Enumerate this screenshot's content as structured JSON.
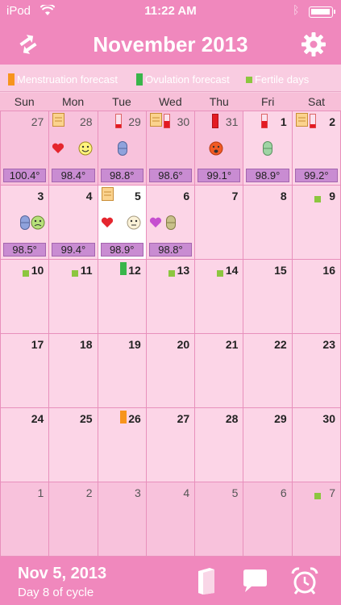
{
  "status_bar": {
    "carrier": "iPod",
    "time": "11:22 AM",
    "battery_level": 0.95
  },
  "header": {
    "title": "November 2013"
  },
  "legend": {
    "items": [
      {
        "label": "Menstruation forecast",
        "color": "#f7941d",
        "icon": "orange-bar"
      },
      {
        "label": "Ovulation forecast",
        "color": "#39b54a",
        "icon": "green-bar"
      },
      {
        "label": "Fertile days",
        "color": "#8cc63f",
        "icon": "green-square"
      }
    ]
  },
  "weekdays": [
    "Sun",
    "Mon",
    "Tue",
    "Wed",
    "Thu",
    "Fri",
    "Sat"
  ],
  "calendar": {
    "days": [
      {
        "d": "27",
        "other": true,
        "temp": "100.4°"
      },
      {
        "d": "28",
        "other": true,
        "temp": "98.4°",
        "icons": [
          "note",
          "heart",
          "smiley-happy"
        ]
      },
      {
        "d": "29",
        "other": true,
        "temp": "98.8°",
        "icons": [
          "flow-light",
          "pill-blue"
        ]
      },
      {
        "d": "30",
        "other": true,
        "temp": "98.6°",
        "icons": [
          "note",
          "flow-medium"
        ]
      },
      {
        "d": "31",
        "other": true,
        "temp": "99.1°",
        "icons": [
          "flow-heavy",
          "smiley-angry"
        ]
      },
      {
        "d": "1",
        "temp": "98.9°",
        "icons": [
          "flow-medium",
          "pill-green"
        ]
      },
      {
        "d": "2",
        "temp": "99.2°",
        "icons": [
          "note",
          "flow-light"
        ]
      },
      {
        "d": "3",
        "temp": "98.5°",
        "icons": [
          "pill-blue",
          "smiley-sad"
        ]
      },
      {
        "d": "4",
        "temp": "99.4°"
      },
      {
        "d": "5",
        "today": true,
        "temp": "98.9°",
        "icons": [
          "note",
          "heart",
          "smiley-neutral"
        ]
      },
      {
        "d": "6",
        "temp": "98.8°",
        "icons": [
          "heart-purple",
          "pill-tan"
        ]
      },
      {
        "d": "7"
      },
      {
        "d": "8"
      },
      {
        "d": "9",
        "icons": [
          "fertile"
        ]
      },
      {
        "d": "10",
        "icons": [
          "fertile"
        ]
      },
      {
        "d": "11",
        "icons": [
          "fertile"
        ]
      },
      {
        "d": "12",
        "icons": [
          "ovulation"
        ]
      },
      {
        "d": "13",
        "icons": [
          "fertile"
        ]
      },
      {
        "d": "14",
        "icons": [
          "fertile"
        ]
      },
      {
        "d": "15"
      },
      {
        "d": "16"
      },
      {
        "d": "17"
      },
      {
        "d": "18"
      },
      {
        "d": "19"
      },
      {
        "d": "20"
      },
      {
        "d": "21"
      },
      {
        "d": "22"
      },
      {
        "d": "23"
      },
      {
        "d": "24"
      },
      {
        "d": "25"
      },
      {
        "d": "26",
        "icons": [
          "menstruation"
        ]
      },
      {
        "d": "27"
      },
      {
        "d": "28"
      },
      {
        "d": "29"
      },
      {
        "d": "30"
      },
      {
        "d": "1",
        "other": true
      },
      {
        "d": "2",
        "other": true
      },
      {
        "d": "3",
        "other": true
      },
      {
        "d": "4",
        "other": true
      },
      {
        "d": "5",
        "other": true
      },
      {
        "d": "6",
        "other": true
      },
      {
        "d": "7",
        "other": true,
        "icons": [
          "fertile"
        ]
      }
    ]
  },
  "footer": {
    "date": "Nov 5, 2013",
    "cycle": "Day 8 of cycle"
  }
}
